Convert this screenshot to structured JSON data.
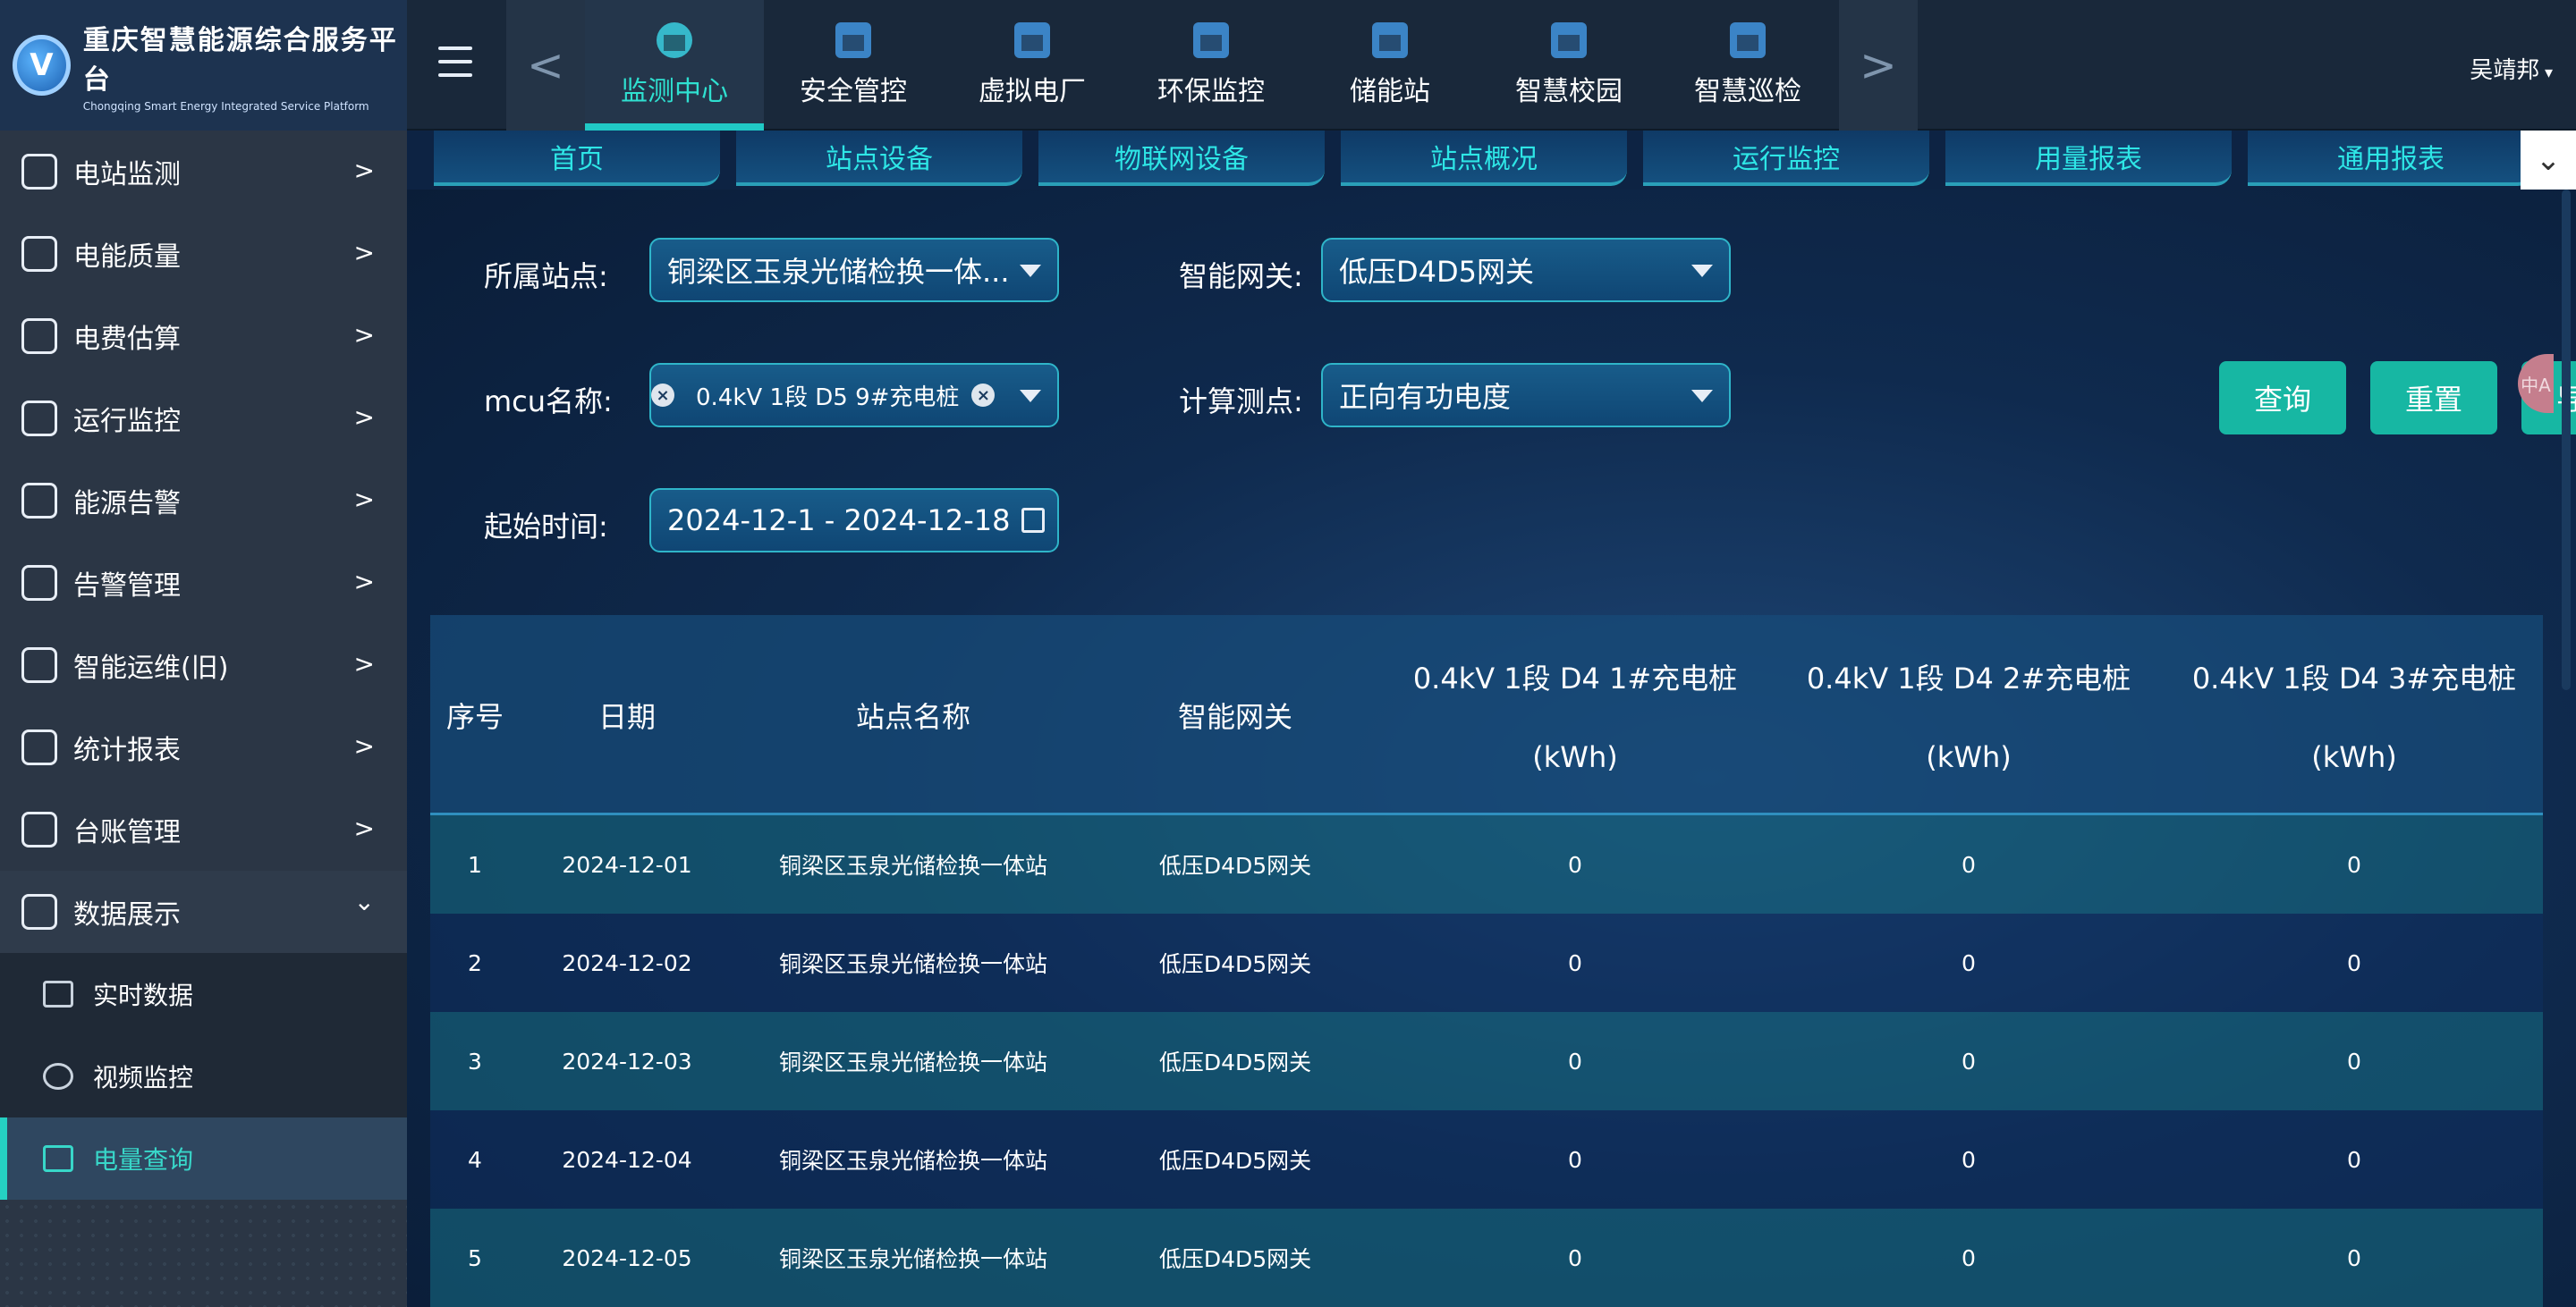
{
  "brand": {
    "name_cn": "重庆智慧能源综合服务平台",
    "name_en": "Chongqing Smart Energy Integrated Service Platform"
  },
  "topnav": {
    "prev": "<",
    "next": ">",
    "items": [
      {
        "label": "监测中心",
        "icon": "monitor-center-icon",
        "active": true
      },
      {
        "label": "安全管控",
        "icon": "building-icon"
      },
      {
        "label": "虚拟电厂",
        "icon": "factory-icon"
      },
      {
        "label": "环保监控",
        "icon": "factory-icon"
      },
      {
        "label": "储能站",
        "icon": "battery-icon"
      },
      {
        "label": "智慧校园",
        "icon": "school-icon"
      },
      {
        "label": "智慧巡检",
        "icon": "factory-icon"
      }
    ]
  },
  "user": {
    "name": "吴靖邦"
  },
  "sidebar": {
    "items": [
      {
        "label": "电站监测",
        "arrow": ">"
      },
      {
        "label": "电能质量",
        "arrow": ">"
      },
      {
        "label": "电费估算",
        "arrow": ">"
      },
      {
        "label": "运行监控",
        "arrow": ">"
      },
      {
        "label": "能源告警",
        "arrow": ">"
      },
      {
        "label": "告警管理",
        "arrow": ">"
      },
      {
        "label": "智能运维(旧)",
        "arrow": ">"
      },
      {
        "label": "统计报表",
        "arrow": ">"
      },
      {
        "label": "台账管理",
        "arrow": ">"
      },
      {
        "label": "数据展示",
        "arrow": "⌄",
        "expanded": true
      }
    ],
    "subitems": [
      {
        "label": "实时数据"
      },
      {
        "label": "视频监控"
      },
      {
        "label": "电量查询",
        "active": true
      }
    ]
  },
  "subtabs": [
    "首页",
    "站点设备",
    "物联网设备",
    "站点概况",
    "运行监控",
    "用量报表",
    "通用报表"
  ],
  "filters": {
    "station_label": "所属站点:",
    "station_value": "铜梁区玉泉光储检换一体...",
    "gateway_label": "智能网关:",
    "gateway_value": "低压D4D5网关",
    "mcu_label": "mcu名称:",
    "mcu_tag": "0.4kV 1段 D5 9#充电桩",
    "point_label": "计算测点:",
    "point_value": "正向有功电度",
    "time_label": "起始时间:",
    "time_value": "2024-12-1 - 2024-12-18",
    "buttons": {
      "query": "查询",
      "reset": "重置",
      "export": "导出"
    },
    "side_chip": "中A"
  },
  "table": {
    "headers": {
      "index": "序号",
      "date": "日期",
      "station": "站点名称",
      "gateway": "智能网关",
      "c1_name": "0.4kV 1段 D4 1#充电桩",
      "c2_name": "0.4kV 1段 D4 2#充电桩",
      "c3_name": "0.4kV 1段 D4 3#充电桩",
      "unit": "(kWh)"
    },
    "rows": [
      {
        "index": "1",
        "date": "2024-12-01",
        "station": "铜梁区玉泉光储检换一体站",
        "gateway": "低压D4D5网关",
        "c1": "0",
        "c2": "0",
        "c3": "0"
      },
      {
        "index": "2",
        "date": "2024-12-02",
        "station": "铜梁区玉泉光储检换一体站",
        "gateway": "低压D4D5网关",
        "c1": "0",
        "c2": "0",
        "c3": "0"
      },
      {
        "index": "3",
        "date": "2024-12-03",
        "station": "铜梁区玉泉光储检换一体站",
        "gateway": "低压D4D5网关",
        "c1": "0",
        "c2": "0",
        "c3": "0"
      },
      {
        "index": "4",
        "date": "2024-12-04",
        "station": "铜梁区玉泉光储检换一体站",
        "gateway": "低压D4D5网关",
        "c1": "0",
        "c2": "0",
        "c3": "0"
      },
      {
        "index": "5",
        "date": "2024-12-05",
        "station": "铜梁区玉泉光储检换一体站",
        "gateway": "低压D4D5网关",
        "c1": "0",
        "c2": "0",
        "c3": "0"
      }
    ]
  },
  "colors": {
    "accent": "#20c9c5",
    "button": "#17b7a3",
    "header_bg": "#19283a",
    "sidebar_bg": "#2b3645"
  }
}
